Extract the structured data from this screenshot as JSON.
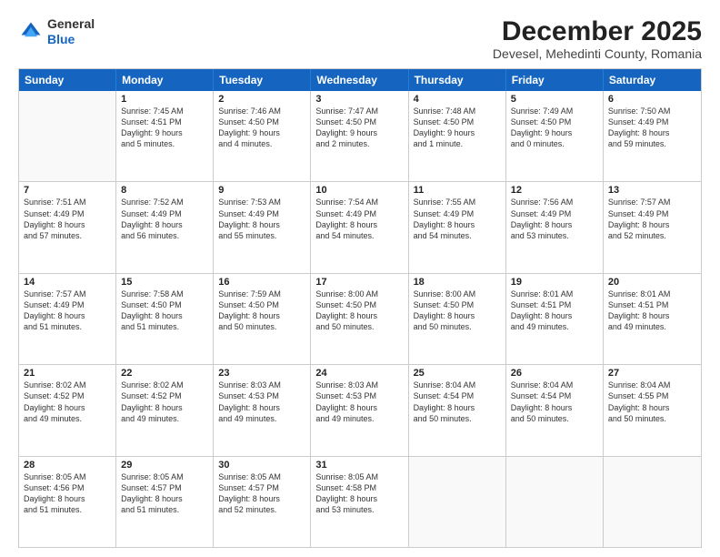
{
  "header": {
    "logo_line1": "General",
    "logo_line2": "Blue",
    "month": "December 2025",
    "location": "Devesel, Mehedinti County, Romania"
  },
  "weekdays": [
    "Sunday",
    "Monday",
    "Tuesday",
    "Wednesday",
    "Thursday",
    "Friday",
    "Saturday"
  ],
  "rows": [
    [
      {
        "day": "",
        "text": ""
      },
      {
        "day": "1",
        "text": "Sunrise: 7:45 AM\nSunset: 4:51 PM\nDaylight: 9 hours\nand 5 minutes."
      },
      {
        "day": "2",
        "text": "Sunrise: 7:46 AM\nSunset: 4:50 PM\nDaylight: 9 hours\nand 4 minutes."
      },
      {
        "day": "3",
        "text": "Sunrise: 7:47 AM\nSunset: 4:50 PM\nDaylight: 9 hours\nand 2 minutes."
      },
      {
        "day": "4",
        "text": "Sunrise: 7:48 AM\nSunset: 4:50 PM\nDaylight: 9 hours\nand 1 minute."
      },
      {
        "day": "5",
        "text": "Sunrise: 7:49 AM\nSunset: 4:50 PM\nDaylight: 9 hours\nand 0 minutes."
      },
      {
        "day": "6",
        "text": "Sunrise: 7:50 AM\nSunset: 4:49 PM\nDaylight: 8 hours\nand 59 minutes."
      }
    ],
    [
      {
        "day": "7",
        "text": "Sunrise: 7:51 AM\nSunset: 4:49 PM\nDaylight: 8 hours\nand 57 minutes."
      },
      {
        "day": "8",
        "text": "Sunrise: 7:52 AM\nSunset: 4:49 PM\nDaylight: 8 hours\nand 56 minutes."
      },
      {
        "day": "9",
        "text": "Sunrise: 7:53 AM\nSunset: 4:49 PM\nDaylight: 8 hours\nand 55 minutes."
      },
      {
        "day": "10",
        "text": "Sunrise: 7:54 AM\nSunset: 4:49 PM\nDaylight: 8 hours\nand 54 minutes."
      },
      {
        "day": "11",
        "text": "Sunrise: 7:55 AM\nSunset: 4:49 PM\nDaylight: 8 hours\nand 54 minutes."
      },
      {
        "day": "12",
        "text": "Sunrise: 7:56 AM\nSunset: 4:49 PM\nDaylight: 8 hours\nand 53 minutes."
      },
      {
        "day": "13",
        "text": "Sunrise: 7:57 AM\nSunset: 4:49 PM\nDaylight: 8 hours\nand 52 minutes."
      }
    ],
    [
      {
        "day": "14",
        "text": "Sunrise: 7:57 AM\nSunset: 4:49 PM\nDaylight: 8 hours\nand 51 minutes."
      },
      {
        "day": "15",
        "text": "Sunrise: 7:58 AM\nSunset: 4:50 PM\nDaylight: 8 hours\nand 51 minutes."
      },
      {
        "day": "16",
        "text": "Sunrise: 7:59 AM\nSunset: 4:50 PM\nDaylight: 8 hours\nand 50 minutes."
      },
      {
        "day": "17",
        "text": "Sunrise: 8:00 AM\nSunset: 4:50 PM\nDaylight: 8 hours\nand 50 minutes."
      },
      {
        "day": "18",
        "text": "Sunrise: 8:00 AM\nSunset: 4:50 PM\nDaylight: 8 hours\nand 50 minutes."
      },
      {
        "day": "19",
        "text": "Sunrise: 8:01 AM\nSunset: 4:51 PM\nDaylight: 8 hours\nand 49 minutes."
      },
      {
        "day": "20",
        "text": "Sunrise: 8:01 AM\nSunset: 4:51 PM\nDaylight: 8 hours\nand 49 minutes."
      }
    ],
    [
      {
        "day": "21",
        "text": "Sunrise: 8:02 AM\nSunset: 4:52 PM\nDaylight: 8 hours\nand 49 minutes."
      },
      {
        "day": "22",
        "text": "Sunrise: 8:02 AM\nSunset: 4:52 PM\nDaylight: 8 hours\nand 49 minutes."
      },
      {
        "day": "23",
        "text": "Sunrise: 8:03 AM\nSunset: 4:53 PM\nDaylight: 8 hours\nand 49 minutes."
      },
      {
        "day": "24",
        "text": "Sunrise: 8:03 AM\nSunset: 4:53 PM\nDaylight: 8 hours\nand 49 minutes."
      },
      {
        "day": "25",
        "text": "Sunrise: 8:04 AM\nSunset: 4:54 PM\nDaylight: 8 hours\nand 50 minutes."
      },
      {
        "day": "26",
        "text": "Sunrise: 8:04 AM\nSunset: 4:54 PM\nDaylight: 8 hours\nand 50 minutes."
      },
      {
        "day": "27",
        "text": "Sunrise: 8:04 AM\nSunset: 4:55 PM\nDaylight: 8 hours\nand 50 minutes."
      }
    ],
    [
      {
        "day": "28",
        "text": "Sunrise: 8:05 AM\nSunset: 4:56 PM\nDaylight: 8 hours\nand 51 minutes."
      },
      {
        "day": "29",
        "text": "Sunrise: 8:05 AM\nSunset: 4:57 PM\nDaylight: 8 hours\nand 51 minutes."
      },
      {
        "day": "30",
        "text": "Sunrise: 8:05 AM\nSunset: 4:57 PM\nDaylight: 8 hours\nand 52 minutes."
      },
      {
        "day": "31",
        "text": "Sunrise: 8:05 AM\nSunset: 4:58 PM\nDaylight: 8 hours\nand 53 minutes."
      },
      {
        "day": "",
        "text": ""
      },
      {
        "day": "",
        "text": ""
      },
      {
        "day": "",
        "text": ""
      }
    ]
  ]
}
